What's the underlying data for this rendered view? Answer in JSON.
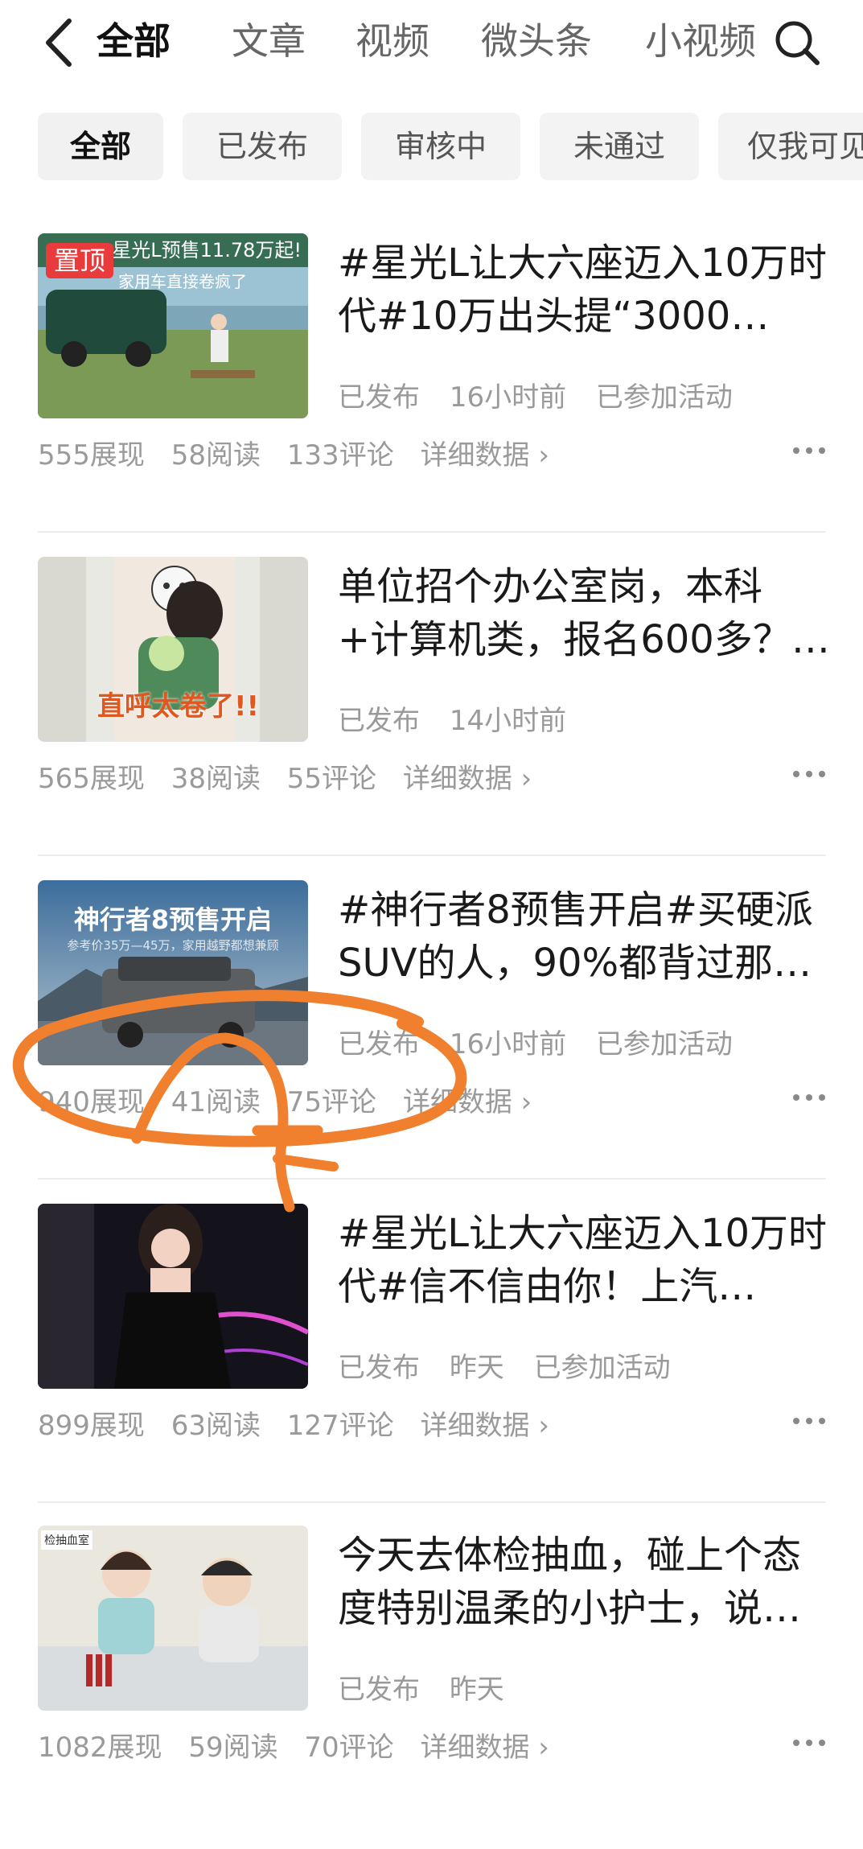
{
  "nav": {
    "tabs": [
      "全部",
      "文章",
      "视频",
      "微头条",
      "小视频"
    ]
  },
  "filters": [
    "全部",
    "已发布",
    "审核中",
    "未通过",
    "仅我可见"
  ],
  "items": [
    {
      "title": "#星光L让大六座迈入10万时代#10万出头提“3000…",
      "status": "已发布",
      "time": "16小时前",
      "activity": "已参加活动",
      "impressions": "555展现",
      "reads": "58阅读",
      "comments": "133评论",
      "detail": "详细数据 ›",
      "pin": "置顶",
      "thumb_text1": "星光L预售11.78万起!",
      "thumb_text2": "家用车直接卷疯了"
    },
    {
      "title": "单位招个办公室岗，本科+计算机类，报名600多？…",
      "status": "已发布",
      "time": "14小时前",
      "activity": "",
      "impressions": "565展现",
      "reads": "38阅读",
      "comments": "55评论",
      "detail": "详细数据 ›",
      "thumb_text1": "直呼太卷了!!"
    },
    {
      "title": "#神行者8预售开启#买硬派SUV的人，90%都背过那…",
      "status": "已发布",
      "time": "16小时前",
      "activity": "已参加活动",
      "impressions": "940展现",
      "reads": "41阅读",
      "comments": "75评论",
      "detail": "详细数据 ›",
      "thumb_text1": "神行者8预售开启",
      "thumb_text2": "参考价35万—45万，家用越野都想兼顾"
    },
    {
      "title": "#星光L让大六座迈入10万时代#信不信由你！上汽…",
      "status": "已发布",
      "time": "昨天",
      "activity": "已参加活动",
      "impressions": "899展现",
      "reads": "63阅读",
      "comments": "127评论",
      "detail": "详细数据 ›"
    },
    {
      "title": "今天去体检抽血，碰上个态度特别温柔的小护士，说…",
      "status": "已发布",
      "time": "昨天",
      "activity": "",
      "impressions": "1082展现",
      "reads": "59阅读",
      "comments": "70评论",
      "detail": "详细数据 ›",
      "thumb_text1": "检抽血室"
    }
  ],
  "colors": {
    "annotation": "#f07f2e",
    "pin": "#e93b3b"
  }
}
